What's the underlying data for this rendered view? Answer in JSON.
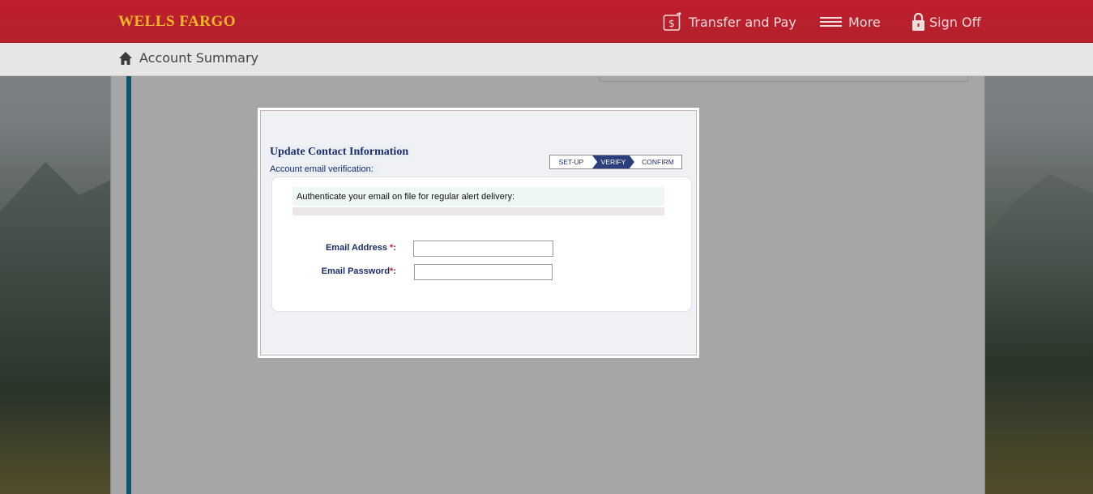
{
  "header": {
    "logo": "WELLS FARGO",
    "nav": {
      "transfer_label": "Transfer and Pay",
      "more_label": "More",
      "signoff_label": "Sign Off"
    }
  },
  "breadcrumb": {
    "label": "Account Summary"
  },
  "modal": {
    "title": "Update Contact Information",
    "subtitle": "Account email verification:",
    "steps": [
      "SET-UP",
      "VERIFY",
      "CONFIRM"
    ],
    "active_step": "VERIFY",
    "note": "Authenticate your email on file for regular alert delivery:",
    "fields": {
      "email_label": "Email Address ",
      "email_required": "*",
      "email_suffix": ":",
      "email_value": "",
      "password_label": "Email Password",
      "password_required": "*",
      "password_suffix": ":",
      "password_value": ""
    }
  },
  "colors": {
    "brand_red": "#bf1e2d",
    "logo_gold": "#f2b826",
    "accent_blue": "#1a82a8",
    "step_active": "#2a3f7b",
    "label_navy": "#1c2d6b"
  }
}
